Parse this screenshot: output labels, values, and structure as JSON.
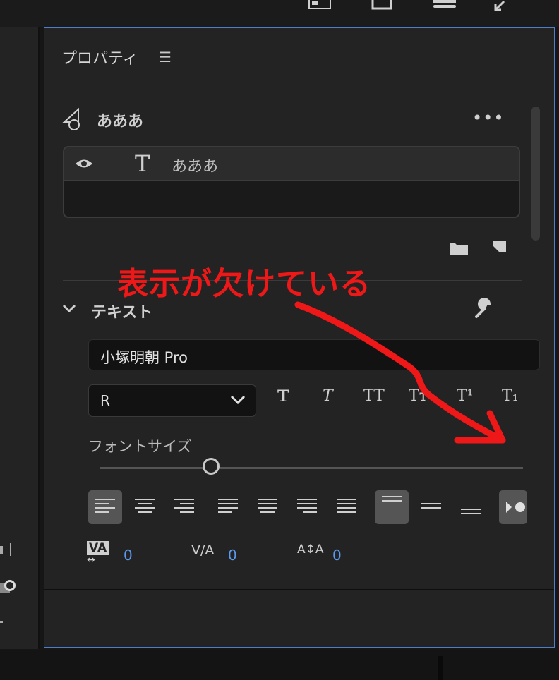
{
  "panel": {
    "title": "プロパティ",
    "menu_icon": "hamburger-icon"
  },
  "group": {
    "name": "あああ",
    "icon": "shape-group-icon",
    "more_icon": "more-dots-icon",
    "more_label": "•••"
  },
  "layers": [
    {
      "name": "あああ",
      "type_icon": "text-layer-icon",
      "visibility_icon": "eye-icon",
      "type_glyph": "T"
    }
  ],
  "layer_actions": {
    "folder_icon": "new-folder-icon",
    "new_layer_icon": "new-layer-icon"
  },
  "text_section": {
    "title": "テキスト",
    "chevron": "❯",
    "settings_icon": "wrench-icon",
    "settings_glyph": "🔧",
    "font_family": "小塚明朝 Pro",
    "font_style": "R",
    "style_buttons": [
      "T",
      "T",
      "TT",
      "Tт",
      "T¹",
      "T₁"
    ],
    "font_size_label": "フォントサイズ"
  },
  "metrics": [
    {
      "icon": "kerning-icon",
      "glyph": "VA",
      "value": "0"
    },
    {
      "icon": "tracking-icon",
      "glyph": "V/A",
      "value": "0"
    },
    {
      "icon": "leading-icon",
      "glyph": "A↕A",
      "value": "0"
    }
  ],
  "annotation": {
    "text": "表示が欠けている",
    "color": "#ef1818"
  },
  "colors": {
    "panel_border": "#4d7ec8",
    "value_blue": "#5b9bf0",
    "panel_bg": "#232323"
  }
}
